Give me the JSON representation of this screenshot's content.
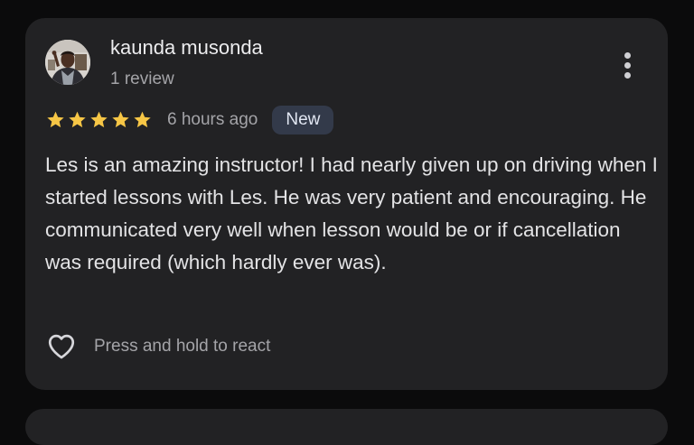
{
  "review": {
    "author_name": "kaunda musonda",
    "author_meta": "1 review",
    "rating": 5,
    "rating_max": 5,
    "time_ago": "6 hours ago",
    "badge": "New",
    "text": "Les is an amazing instructor! I had nearly given up on driving when I started lessons with Les. He was very patient and encouraging. He communicated very well when lesson would be or if cancellation was required (which hardly ever was).",
    "react_hint": "Press and hold to react"
  },
  "icons": {
    "menu": "more-vert-icon",
    "star": "star-icon",
    "react": "heart-outline-icon"
  },
  "colors": {
    "background": "#0b0b0c",
    "card": "#222224",
    "star": "#f6c646",
    "badge_bg": "#333a4a",
    "primary_text": "#e3e3e5",
    "secondary_text": "#a4a4a8"
  }
}
